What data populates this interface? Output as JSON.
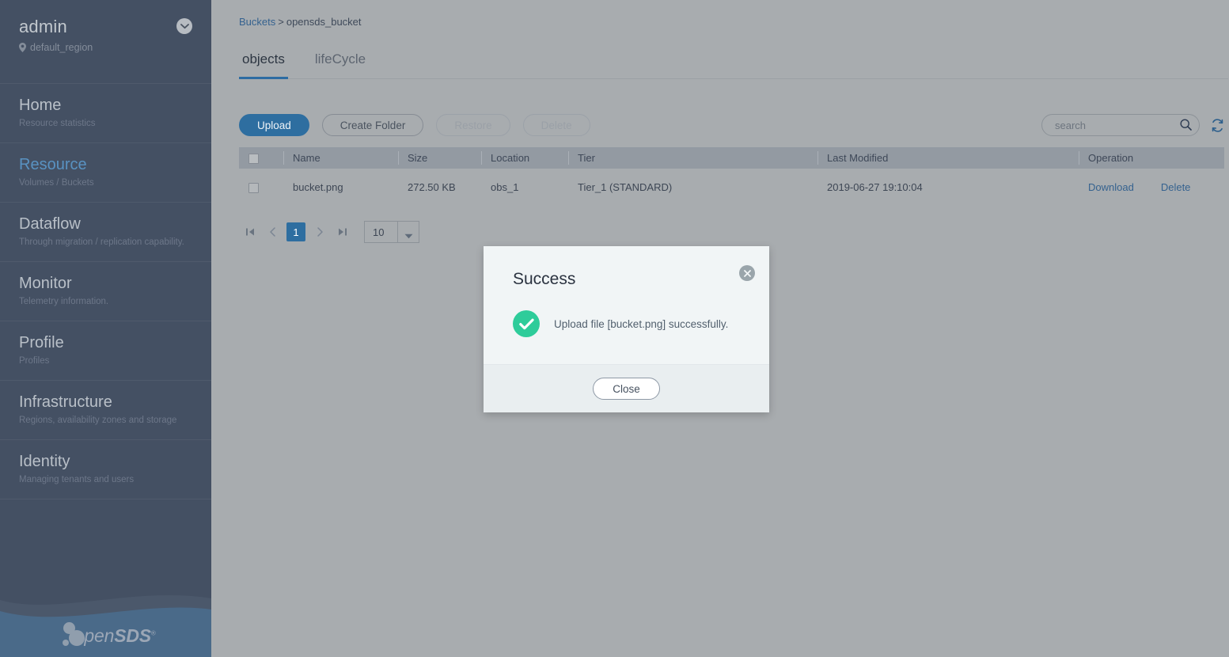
{
  "sidebar": {
    "user": {
      "name": "admin",
      "region": "default_region",
      "chevron_icon": "chevron-down-icon",
      "region_icon": "location-pin-icon"
    },
    "items": [
      {
        "title": "Home",
        "sub": "Resource statistics",
        "active": false
      },
      {
        "title": "Resource",
        "sub": "Volumes / Buckets",
        "active": true
      },
      {
        "title": "Dataflow",
        "sub": "Through migration / replication capability.",
        "active": false
      },
      {
        "title": "Monitor",
        "sub": "Telemetry information.",
        "active": false
      },
      {
        "title": "Profile",
        "sub": "Profiles",
        "active": false
      },
      {
        "title": "Infrastructure",
        "sub": "Regions, availability zones and storage",
        "active": false
      },
      {
        "title": "Identity",
        "sub": "Managing tenants and users",
        "active": false
      }
    ],
    "logo": {
      "pen": "pen",
      "sds": "SDS",
      "reg": "®"
    }
  },
  "breadcrumb": {
    "root": "Buckets",
    "separator": ">",
    "current": "opensds_bucket"
  },
  "tabs": [
    {
      "label": "objects",
      "active": true
    },
    {
      "label": "lifeCycle",
      "active": false
    }
  ],
  "toolbar": {
    "upload_label": "Upload",
    "create_folder_label": "Create Folder",
    "restore_label": "Restore",
    "delete_label": "Delete",
    "search_placeholder": "search",
    "search_value": "",
    "search_icon": "search-icon",
    "refresh_icon": "refresh-icon"
  },
  "table": {
    "columns": [
      "Name",
      "Size",
      "Location",
      "Tier",
      "Last Modified",
      "Operation"
    ],
    "rows": [
      {
        "name": "bucket.png",
        "size": "272.50 KB",
        "location": "obs_1",
        "tier": "Tier_1 (STANDARD)",
        "last_modified": "2019-06-27 19:10:04",
        "download_label": "Download",
        "delete_label": "Delete"
      }
    ]
  },
  "pagination": {
    "first_icon": "first-page-icon",
    "prev_icon": "prev-page-icon",
    "current_page": "1",
    "next_icon": "next-page-icon",
    "last_icon": "last-page-icon",
    "page_size": "10",
    "page_size_caret": "caret-down-icon"
  },
  "modal": {
    "title": "Success",
    "message": "Upload file [bucket.png] successfully.",
    "close_button_label": "Close",
    "close_icon": "close-x-icon",
    "status_icon": "success-check-icon"
  },
  "colors": {
    "sidebar_bg": "#22304a",
    "accent_blue": "#2e6ea0",
    "active_link": "#3f8fd1",
    "success_green": "#2ecc9a",
    "page_bg": "#a8acaf",
    "table_header_bg": "#939aa2",
    "modal_bg": "#f1f5f6"
  }
}
